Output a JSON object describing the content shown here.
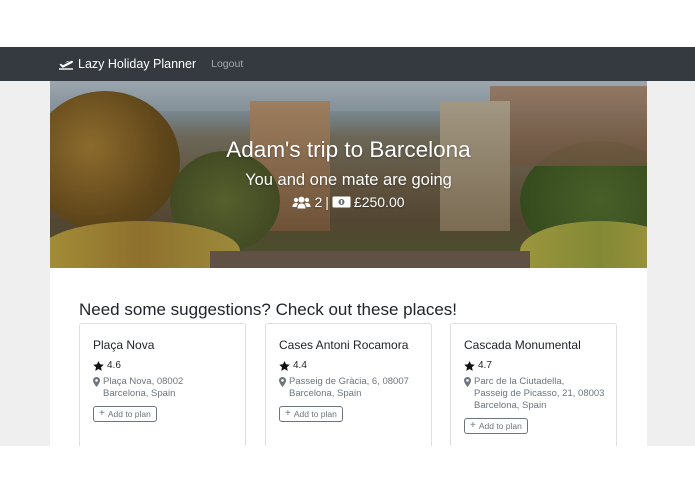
{
  "navbar": {
    "brand_label": "Lazy Holiday Planner",
    "logout_label": "Logout",
    "brand_icon": "plane-departure-icon"
  },
  "hero": {
    "title": "Adam's trip to Barcelona",
    "subtitle": "You and one mate are going",
    "travellers": "2",
    "separator": "|",
    "budget": "£250.00",
    "people_icon": "users-icon",
    "money_icon": "money-bill-icon"
  },
  "suggestions": {
    "heading": "Need some suggestions? Check out these places!",
    "add_label": "Add to plan",
    "places": [
      {
        "name": "Plaça Nova",
        "rating": "4.6",
        "address": [
          "Plaça Nova, 08002",
          "Barcelona, Spain"
        ]
      },
      {
        "name": "Cases Antoni Rocamora",
        "rating": "4.4",
        "address": [
          "Passeig de Gràcia, 6, 08007",
          "Barcelona, Spain"
        ]
      },
      {
        "name": "Cascada Monumental",
        "rating": "4.7",
        "address": [
          "Parc de la Ciutadella,",
          "Passeig de Picasso, 21, 08003",
          "Barcelona, Spain"
        ]
      }
    ]
  },
  "colors": {
    "navbar_bg": "#343a40",
    "page_bg": "#efefef",
    "muted_text": "#6c757d"
  }
}
